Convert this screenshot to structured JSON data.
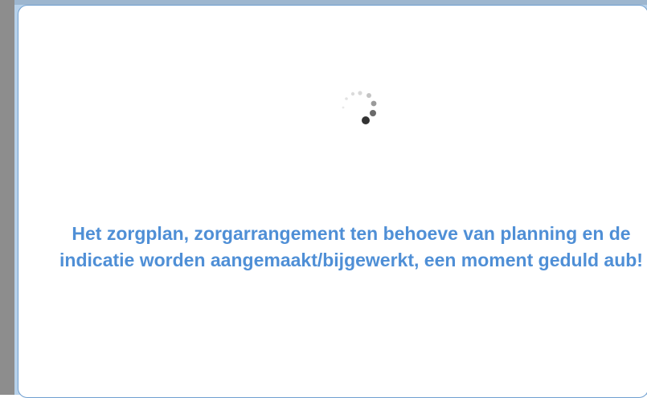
{
  "dialog": {
    "message": "Het zorgplan, zorgarrangement ten behoeve van planning en de indicatie worden aangemaakt/bijgewerkt, een moment geduld aub!",
    "spinner_icon": "loading-spinner-icon"
  },
  "colors": {
    "backdrop": "#b7d1ea",
    "message_text": "#4f8fd6",
    "dialog_border": "#6f9fd0",
    "spinner_dark": "#333333"
  }
}
